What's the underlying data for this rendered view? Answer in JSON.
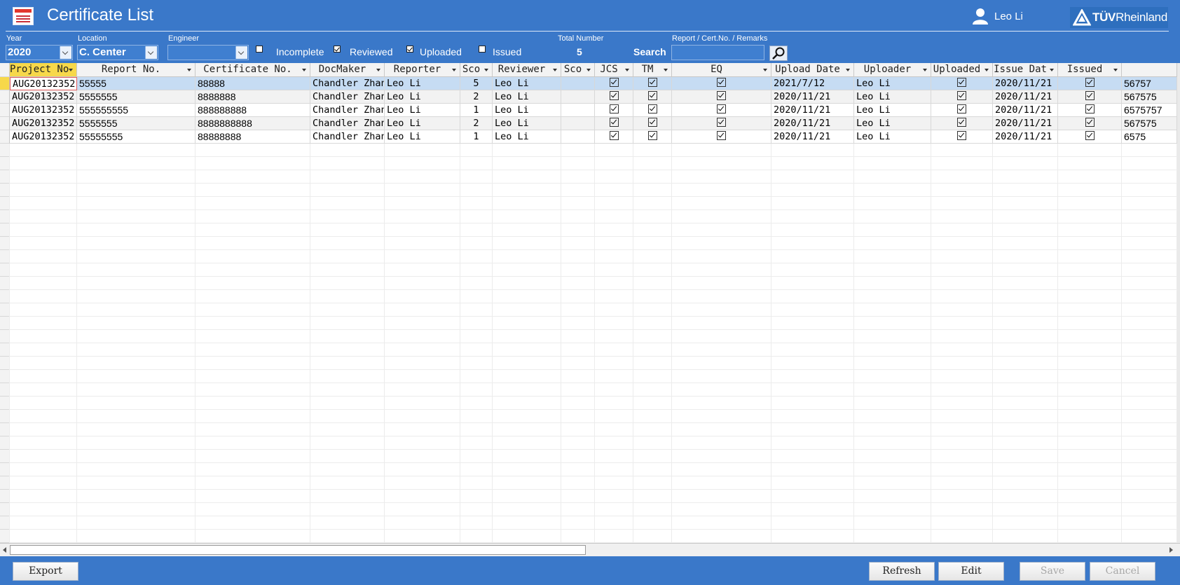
{
  "window": {
    "title": "Certificate List",
    "user": "Leo Li",
    "logo_strong": "TÜV",
    "logo_rest": "Rheinland"
  },
  "filters": {
    "year_label": "Year",
    "year_value": "2020",
    "location_label": "Location",
    "location_value": "C. Center",
    "engineer_label": "Engineer",
    "engineer_value": "",
    "incomplete": {
      "label": "Incomplete",
      "checked": false
    },
    "reviewed": {
      "label": "Reviewed",
      "checked": true
    },
    "uploaded": {
      "label": "Uploaded",
      "checked": true
    },
    "issued": {
      "label": "Issued",
      "checked": false
    },
    "total_label": "Total Number",
    "total_value": "5",
    "search_label": "Search",
    "search_hint": "Report / Cert.No. / Remarks",
    "search_value": ""
  },
  "table": {
    "columns": [
      "Project No",
      "Report No.",
      "Certificate No.",
      "DocMaker",
      "Reporter",
      "Sco",
      "Reviewer",
      "Sco",
      "JCS",
      "TM",
      "EQ",
      "Upload Date",
      "Uploader",
      "Uploaded",
      "Issue Dat",
      "Issued",
      ""
    ],
    "rows": [
      [
        "AUG20132352",
        "55555",
        "88888",
        "Chandler Zhang",
        "Leo Li",
        "5",
        "Leo Li",
        "",
        true,
        true,
        true,
        "2021/7/12",
        "Leo Li",
        true,
        "2020/11/21",
        true,
        "56757"
      ],
      [
        "AUG20132352",
        "5555555",
        "8888888",
        "Chandler Zhang",
        "Leo Li",
        "2",
        "Leo Li",
        "",
        true,
        true,
        true,
        "2020/11/21",
        "Leo Li",
        true,
        "2020/11/21",
        true,
        "567575"
      ],
      [
        "AUG20132352",
        "555555555",
        "888888888",
        "Chandler Zhang",
        "Leo Li",
        "1",
        "Leo Li",
        "",
        true,
        true,
        true,
        "2020/11/21",
        "Leo Li",
        true,
        "2020/11/21",
        true,
        "6575757"
      ],
      [
        "AUG20132352",
        "5555555",
        "8888888888",
        "Chandler Zhang",
        "Leo Li",
        "2",
        "Leo Li",
        "",
        true,
        true,
        true,
        "2020/11/21",
        "Leo Li",
        true,
        "2020/11/21",
        true,
        "567575"
      ],
      [
        "AUG20132352",
        "55555555",
        "88888888",
        "Chandler Zhang",
        "Leo Li",
        "1",
        "Leo Li",
        "",
        true,
        true,
        true,
        "2020/11/21",
        "Leo Li",
        true,
        "2020/11/21",
        true,
        "6575"
      ]
    ]
  },
  "buttons": {
    "export": "Export",
    "refresh": "Refresh",
    "edit": "Edit",
    "save": "Save",
    "cancel": "Cancel"
  },
  "colors": {
    "background": "#3a78c9",
    "selected_row": "#c6dcf3",
    "header_selected": "#f7d84a"
  }
}
